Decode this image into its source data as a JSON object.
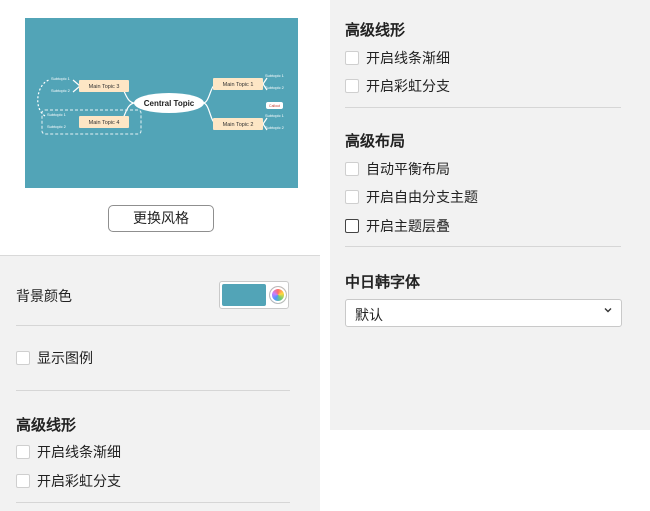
{
  "preview": {
    "central_topic": "Central Topic",
    "main_topic_1": "Main Topic 1",
    "main_topic_2": "Main Topic 2",
    "main_topic_3": "Main Topic 3",
    "main_topic_4": "Main Topic 4",
    "subtopic_1": "Subtopic 1",
    "subtopic_2": "Subtopic 2",
    "callout": "Callout"
  },
  "change_style_button": "更换风格",
  "left": {
    "bg_color_label": "背景颜色",
    "bg_color_value": "#52a4b7",
    "show_legend": "显示图例",
    "advanced_lines_title": "高级线形",
    "taper_lines": "开启线条渐细",
    "rainbow_branch": "开启彩虹分支"
  },
  "right": {
    "advanced_lines_title": "高级线形",
    "taper_lines": "开启线条渐细",
    "rainbow_branch": "开启彩虹分支",
    "advanced_layout_title": "高级布局",
    "auto_balance": "自动平衡布局",
    "free_branch_topic": "开启自由分支主题",
    "topic_overlap": "开启主题层叠",
    "cjk_font_title": "中日韩字体",
    "cjk_font_value": "默认"
  }
}
